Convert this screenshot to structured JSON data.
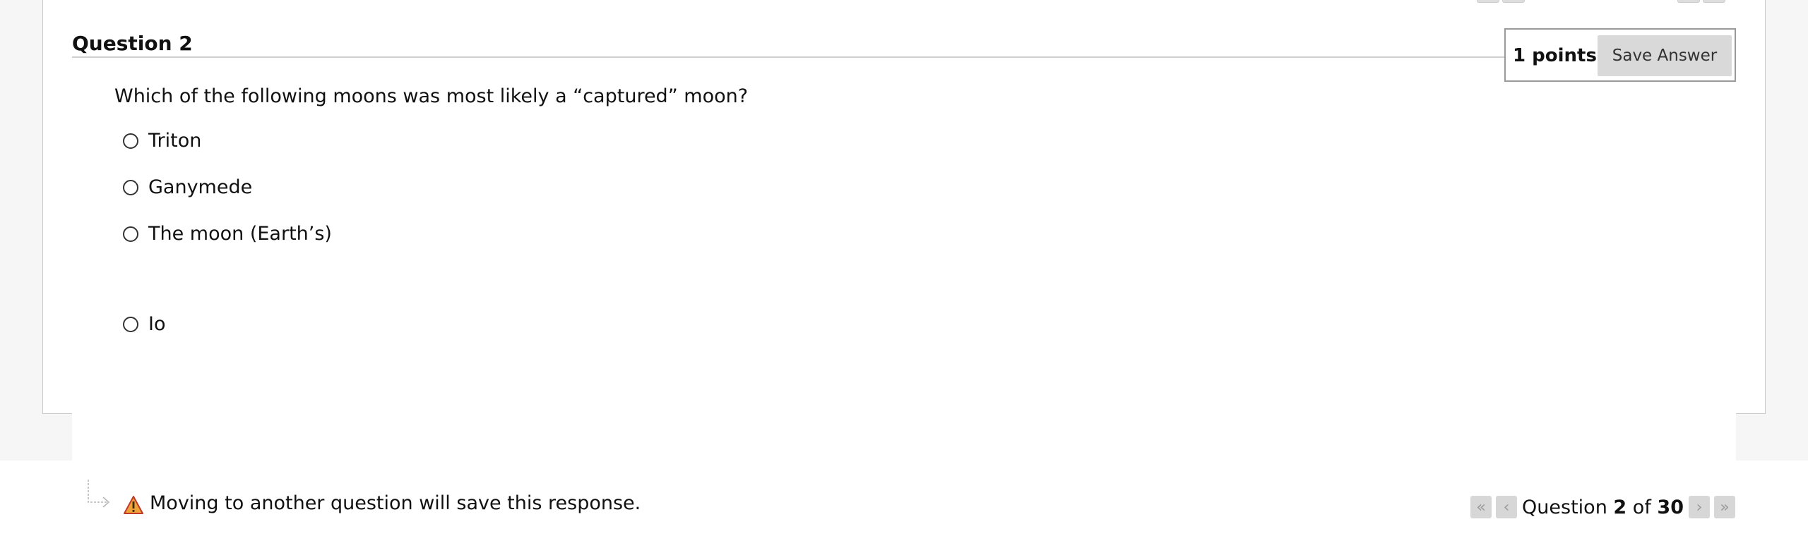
{
  "question": {
    "header": "Question 2",
    "points": "1 points",
    "save_label": "Save Answer",
    "text": "Which of the following moons was most likely a “captured” moon?",
    "options": [
      "Triton",
      "Ganymede",
      "The moon (Earth’s)",
      "Io"
    ]
  },
  "footer": {
    "message": "Moving to another question will save this response."
  },
  "pagination": {
    "prefix": "Question",
    "current": "2",
    "of_label": "of",
    "total": "30"
  },
  "icons": {
    "first": "double-chevron-left-icon",
    "prev": "chevron-left-icon",
    "next": "chevron-right-icon",
    "last": "double-chevron-right-icon",
    "warning": "warning-icon",
    "arrow": "corner-arrow-icon"
  },
  "colors": {
    "warning_fill": "#f0a23a",
    "button_bg": "#d9d9d9"
  }
}
